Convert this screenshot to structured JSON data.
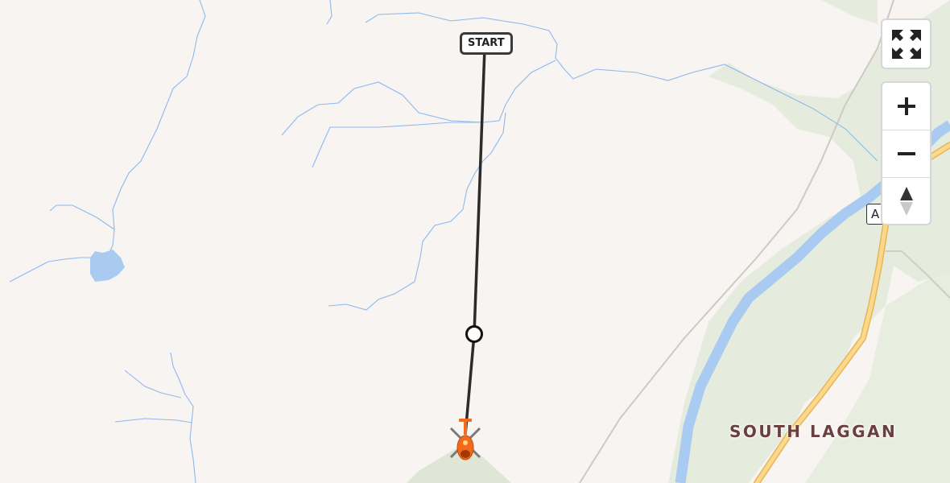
{
  "map": {
    "place_label": "SOUTH LAGGAN",
    "start_label": "START",
    "road_shield": "A",
    "colors": {
      "background": "#f7f4f1",
      "water": "#a9cbf2",
      "stream": "#8fb8ee",
      "vegetation": "#d9e6d0",
      "road_fill": "#fcd98a",
      "road_casing": "#e7b45a",
      "route": "#2b2b2b",
      "helicopter": "#f26a1b"
    }
  },
  "controls": {
    "fullscreen_icon": "expand-arrows-icon",
    "zoom_in_icon": "plus-icon",
    "zoom_out_icon": "minus-icon",
    "compass_icon": "north-arrow-icon"
  }
}
